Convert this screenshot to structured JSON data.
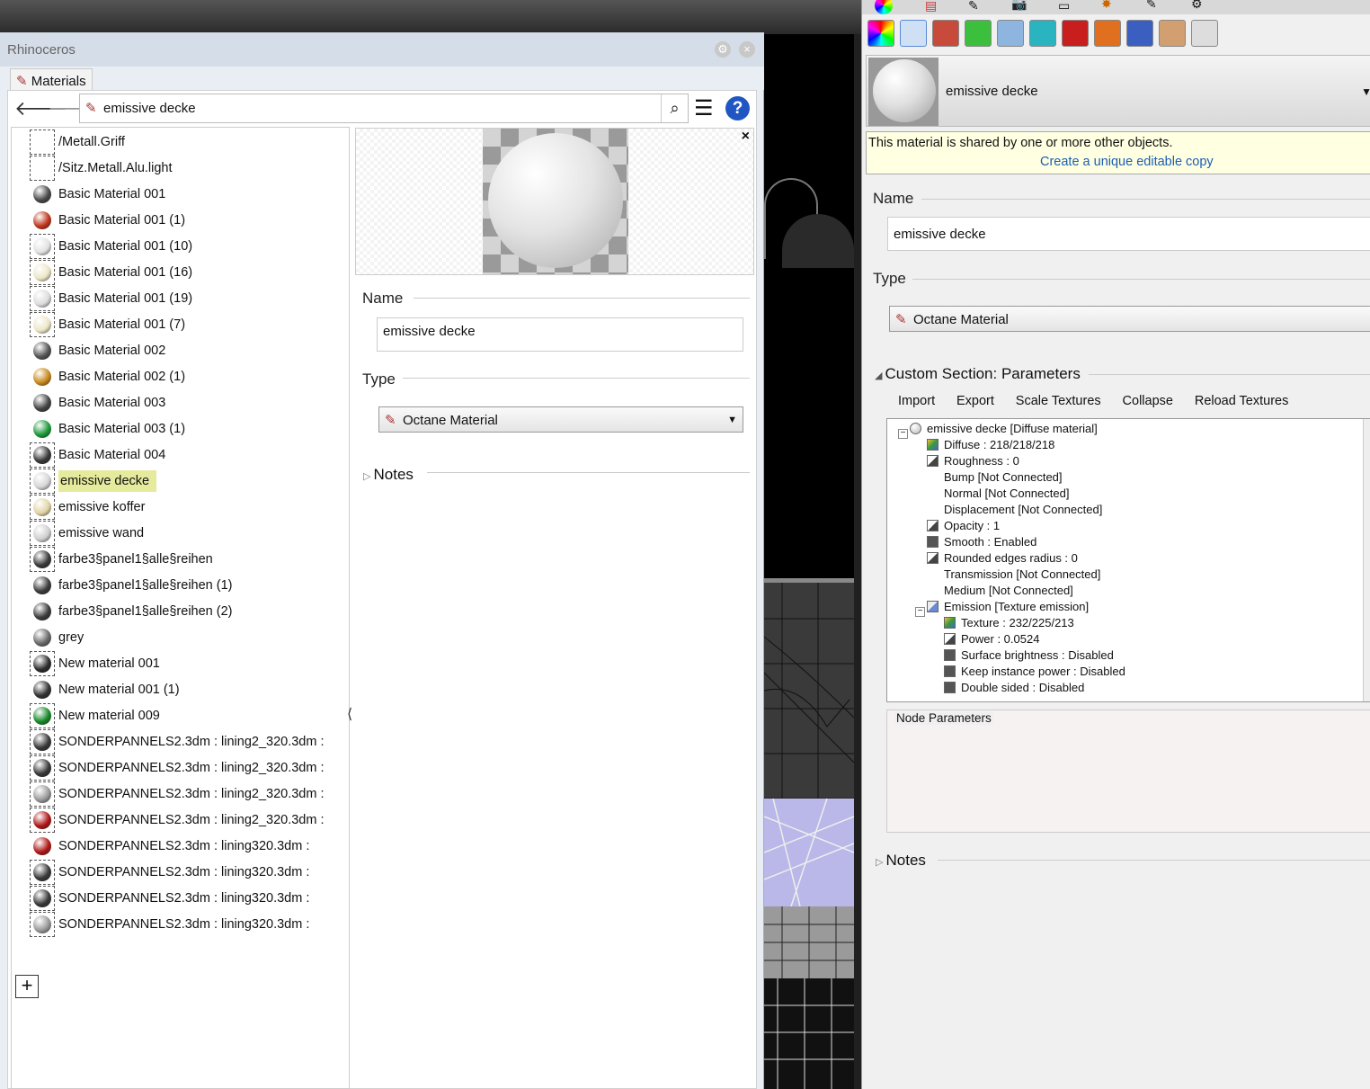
{
  "app": {
    "title": "Rhinoceros"
  },
  "materials_panel": {
    "tab_label": "Materials",
    "search_value": "emissive decke",
    "items": [
      {
        "label": "/Metall.Griff",
        "ball": null,
        "framed": true
      },
      {
        "label": "/Sitz.Metall.Alu.light",
        "ball": null,
        "framed": true
      },
      {
        "label": "Basic Material 001",
        "ball": "#4a4a4a"
      },
      {
        "label": "Basic Material 001 (1)",
        "ball": "#c0361c"
      },
      {
        "label": "Basic Material 001 (10)",
        "ball": "#e2e2e2",
        "framed": true
      },
      {
        "label": "Basic Material 001 (16)",
        "ball": "#ece6c6",
        "framed": true
      },
      {
        "label": "Basic Material 001 (19)",
        "ball": "#dcdcdc",
        "framed": true
      },
      {
        "label": "Basic Material 001 (7)",
        "ball": "#ece6c6",
        "framed": true
      },
      {
        "label": "Basic Material 002",
        "ball": "#555555"
      },
      {
        "label": "Basic Material 002 (1)",
        "ball": "#c88a1e"
      },
      {
        "label": "Basic Material 003",
        "ball": "#454545"
      },
      {
        "label": "Basic Material 003 (1)",
        "ball": "#1e9a3a"
      },
      {
        "label": "Basic Material 004",
        "ball": "#3a3a3a",
        "framed": true
      },
      {
        "label": "emissive decke",
        "ball": "#d6d6d6",
        "framed": true,
        "selected": true
      },
      {
        "label": "emissive koffer",
        "ball": "#e2d4a6",
        "framed": true
      },
      {
        "label": "emissive wand",
        "ball": "#cfcfcf",
        "framed": true
      },
      {
        "label": "farbe3§panel1§alle§reihen",
        "ball": "#3a3a3a",
        "framed": true
      },
      {
        "label": "farbe3§panel1§alle§reihen (1)",
        "ball": "#3c3c3c"
      },
      {
        "label": "farbe3§panel1§alle§reihen (2)",
        "ball": "#3c3c3c"
      },
      {
        "label": "grey",
        "ball": "#6a6a6a"
      },
      {
        "label": "New material 001",
        "ball": "#2e2e2e",
        "framed": true
      },
      {
        "label": "New material 001 (1)",
        "ball": "#333333"
      },
      {
        "label": "New material 009",
        "ball": "#1a8a2a",
        "framed": true
      },
      {
        "label": "SONDERPANNELS2.3dm : lining2_320.3dm :",
        "ball": "#3a3a3a",
        "framed": true
      },
      {
        "label": "SONDERPANNELS2.3dm : lining2_320.3dm :",
        "ball": "#3a3a3a",
        "framed": true
      },
      {
        "label": "SONDERPANNELS2.3dm : lining2_320.3dm :",
        "ball": "#9a9a9a",
        "framed": true
      },
      {
        "label": "SONDERPANNELS2.3dm : lining2_320.3dm :",
        "ball": "#b01818",
        "framed": true
      },
      {
        "label": "SONDERPANNELS2.3dm : lining320.3dm :",
        "ball": "#b01818"
      },
      {
        "label": "SONDERPANNELS2.3dm : lining320.3dm :",
        "ball": "#3a3a3a",
        "framed": true
      },
      {
        "label": "SONDERPANNELS2.3dm : lining320.3dm :",
        "ball": "#3a3a3a",
        "framed": true
      },
      {
        "label": "SONDERPANNELS2.3dm : lining320.3dm :",
        "ball": "#9a9a9a",
        "framed": true
      }
    ],
    "detail": {
      "name_label": "Name",
      "name_value": "emissive decke",
      "type_label": "Type",
      "type_value": "Octane Material",
      "notes_label": "Notes"
    }
  },
  "properties_panel": {
    "material_name": "emissive decke",
    "shared_notice": "This material is shared by one or more other objects.",
    "unique_copy_link": "Create a unique editable copy",
    "name_label": "Name",
    "name_value": "emissive decke",
    "type_label": "Type",
    "type_value": "Octane Material",
    "section_title": "Custom Section: Parameters",
    "buttons": [
      "Import",
      "Export",
      "Scale Textures",
      "Collapse",
      "Reload Textures"
    ],
    "tree": [
      {
        "text": "emissive decke  [Diffuse material]",
        "level": 0,
        "icon": "sphere-icon"
      },
      {
        "text": "Diffuse : 218/218/218",
        "level": 1,
        "icon": "color-icon"
      },
      {
        "text": "Roughness : 0",
        "level": 1,
        "icon": "float-icon"
      },
      {
        "text": "Bump  [Not Connected]",
        "level": 1,
        "icon": null
      },
      {
        "text": "Normal  [Not Connected]",
        "level": 1,
        "icon": null
      },
      {
        "text": "Displacement  [Not Connected]",
        "level": 1,
        "icon": null
      },
      {
        "text": "Opacity : 1",
        "level": 1,
        "icon": "float-icon"
      },
      {
        "text": "Smooth : Enabled",
        "level": 1,
        "icon": "bool-icon"
      },
      {
        "text": "Rounded edges radius : 0",
        "level": 1,
        "icon": "float-icon"
      },
      {
        "text": "Transmission  [Not Connected]",
        "level": 1,
        "icon": null
      },
      {
        "text": "Medium  [Not Connected]",
        "level": 1,
        "icon": null
      },
      {
        "text": "Emission  [Texture emission]",
        "level": 1,
        "icon": "emission-icon"
      },
      {
        "text": "Texture : 232/225/213",
        "level": 2,
        "icon": "color-icon"
      },
      {
        "text": "Power : 0.0524",
        "level": 2,
        "icon": "float-icon"
      },
      {
        "text": "Surface brightness : Disabled",
        "level": 2,
        "icon": "bool-icon"
      },
      {
        "text": "Keep instance power : Disabled",
        "level": 2,
        "icon": "bool-icon"
      },
      {
        "text": "Double sided : Disabled",
        "level": 2,
        "icon": "bool-icon"
      }
    ],
    "node_params_label": "Node Parameters",
    "notes_label": "Notes"
  },
  "colors": {
    "accent_link": "#1a5fb4",
    "selection": "#e6ea9c",
    "notice_bg": "#ffffe1"
  }
}
